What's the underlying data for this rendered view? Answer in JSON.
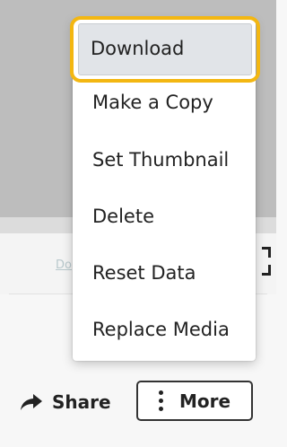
{
  "menu": {
    "items": [
      {
        "label": "Download"
      },
      {
        "label": "Make a Copy"
      },
      {
        "label": "Set Thumbnail"
      },
      {
        "label": "Delete"
      },
      {
        "label": "Reset Data"
      },
      {
        "label": "Replace Media"
      }
    ],
    "highlight_color": "#f3b712"
  },
  "actions": {
    "share_label": "Share",
    "more_label": "More"
  },
  "colors": {
    "preview_bg": "#bdbdbd",
    "page_bg": "#f7f7f7"
  },
  "icons": {
    "share": "share-arrow-icon",
    "more": "vertical-ellipsis-icon",
    "fullscreen": "fullscreen-icon"
  }
}
